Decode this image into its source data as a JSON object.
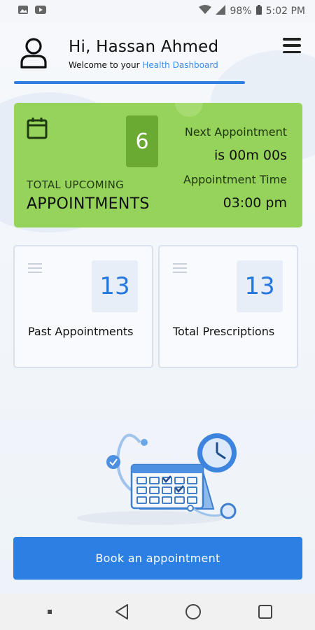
{
  "status_bar": {
    "battery": "98%",
    "time": "5:02 PM",
    "icons": [
      "gallery-icon",
      "youtube-icon",
      "wifi-icon",
      "signal-icon",
      "battery-icon"
    ]
  },
  "header": {
    "greeting": "Hi, Hassan Ahmed",
    "welcome_prefix": "Welcome to your ",
    "welcome_highlight": "Health Dashboard",
    "avatar_icon": "user-icon",
    "menu_icon": "hamburger-menu-icon"
  },
  "upcoming": {
    "count": "6",
    "subtitle": "TOTAL UPCOMING",
    "title": "APPOINTMENTS",
    "next_label": "Next Appointment",
    "next_value": "is 00m 00s",
    "time_label": "Appointment Time",
    "time_value": "03:00 pm",
    "icon": "calendar-icon"
  },
  "stats": [
    {
      "value": "13",
      "label": "Past Appointments"
    },
    {
      "value": "13",
      "label": "Total Prescriptions"
    }
  ],
  "book_button": "Book an appointment",
  "nav": {
    "icons": [
      "recents-dot-icon",
      "back-icon",
      "home-icon",
      "overview-icon"
    ]
  },
  "colors": {
    "accent": "#2c80e4",
    "card_green": "#95d35a",
    "count_green": "#6aaa32",
    "link": "#3a8dee"
  }
}
